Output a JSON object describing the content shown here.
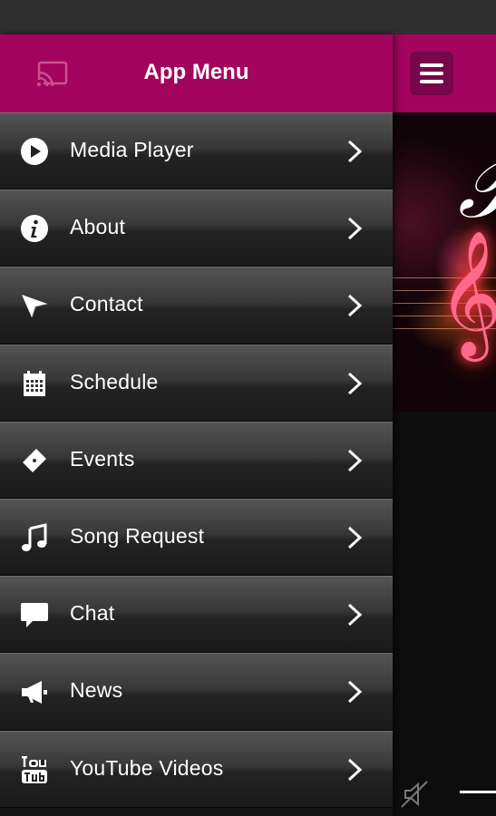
{
  "drawer": {
    "title": "App Menu",
    "items": [
      {
        "label": "Media Player",
        "icon": "play-icon"
      },
      {
        "label": "About",
        "icon": "info-icon"
      },
      {
        "label": "Contact",
        "icon": "send-icon"
      },
      {
        "label": "Schedule",
        "icon": "calendar-icon"
      },
      {
        "label": "Events",
        "icon": "ticket-icon"
      },
      {
        "label": "Song Request",
        "icon": "music-note-icon"
      },
      {
        "label": "Chat",
        "icon": "chat-bubble-icon"
      },
      {
        "label": "News",
        "icon": "megaphone-icon"
      },
      {
        "label": "YouTube Videos",
        "icon": "youtube-icon"
      }
    ]
  },
  "header_icons": {
    "cast": "cast-icon",
    "menu": "hamburger-icon"
  },
  "colors": {
    "accent": "#a3045d",
    "accent_dark": "#78064a",
    "status_bar": "#2f2f2f"
  }
}
